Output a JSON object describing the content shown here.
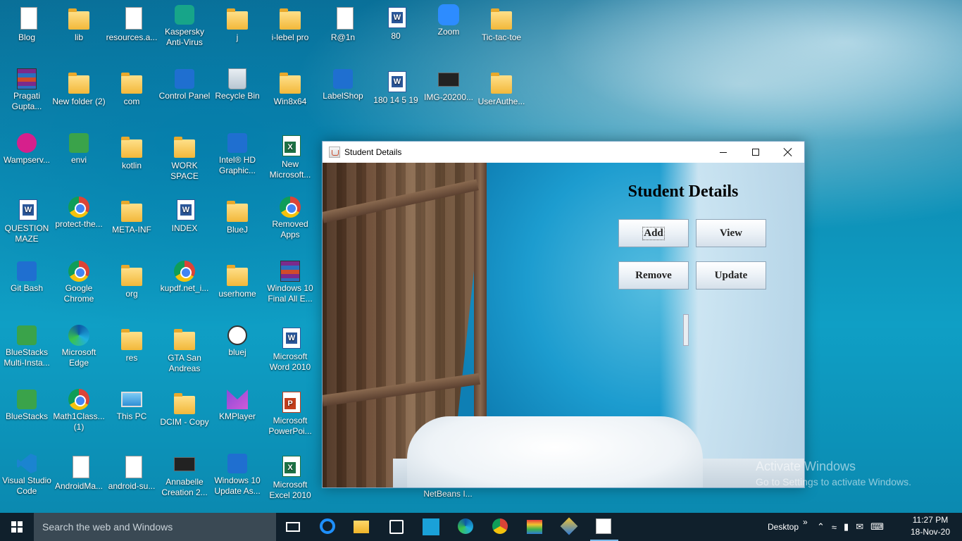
{
  "desktop": {
    "icons": [
      {
        "label": "Blog"
      },
      {
        "label": "lib"
      },
      {
        "label": "resources.a..."
      },
      {
        "label": "Kaspersky Anti-Virus"
      },
      {
        "label": "j"
      },
      {
        "label": "i-lebel pro"
      },
      {
        "label": "R@1n"
      },
      {
        "label": "80"
      },
      {
        "label": "Zoom"
      },
      {
        "label": "Tic-tac-toe"
      },
      {
        "label": "Pragati Gupta..."
      },
      {
        "label": "New folder (2)"
      },
      {
        "label": "com"
      },
      {
        "label": "Control Panel"
      },
      {
        "label": "Recycle Bin"
      },
      {
        "label": "Win8x64"
      },
      {
        "label": "LabelShop"
      },
      {
        "label": "180 14 5 19"
      },
      {
        "label": "IMG-20200..."
      },
      {
        "label": "UserAuthe..."
      },
      {
        "label": "Wampserv..."
      },
      {
        "label": "envi"
      },
      {
        "label": "kotlin"
      },
      {
        "label": "WORK SPACE"
      },
      {
        "label": "Intel® HD Graphic..."
      },
      {
        "label": "New Microsoft..."
      },
      {
        "label": "QUESTION MAZE"
      },
      {
        "label": "protect-the..."
      },
      {
        "label": "META-INF"
      },
      {
        "label": "INDEX"
      },
      {
        "label": "BlueJ"
      },
      {
        "label": "Removed Apps"
      },
      {
        "label": "Git Bash"
      },
      {
        "label": "Google Chrome"
      },
      {
        "label": "org"
      },
      {
        "label": "kupdf.net_i..."
      },
      {
        "label": "userhome"
      },
      {
        "label": "Windows 10 Final All E..."
      },
      {
        "label": "BlueStacks Multi-Insta..."
      },
      {
        "label": "Microsoft Edge"
      },
      {
        "label": "res"
      },
      {
        "label": "GTA San Andreas"
      },
      {
        "label": "bluej"
      },
      {
        "label": "Microsoft Word 2010"
      },
      {
        "label": "BlueStacks"
      },
      {
        "label": "Math1Class... (1)"
      },
      {
        "label": "This PC"
      },
      {
        "label": "DCIM - Copy"
      },
      {
        "label": "KMPlayer"
      },
      {
        "label": "Microsoft PowerPoi..."
      },
      {
        "label": "Visual Studio Code"
      },
      {
        "label": "AndroidMa..."
      },
      {
        "label": "android-su..."
      },
      {
        "label": "Annabelle Creation 2..."
      },
      {
        "label": "Windows 10 Update As..."
      },
      {
        "label": "Microsoft Excel 2010"
      }
    ],
    "netbeans_label": "NetBeans I...",
    "watermark": {
      "line1": "Activate Windows",
      "line2": "Go to Settings to activate Windows."
    }
  },
  "window": {
    "title": "Student Details",
    "heading": "Student Details",
    "buttons": {
      "add": "Add",
      "view": "View",
      "remove": "Remove",
      "update": "Update"
    }
  },
  "taskbar": {
    "search_placeholder": "Search the web and Windows",
    "desktop_label": "Desktop",
    "chevron": "»",
    "time": "11:27 PM",
    "date": "18-Nov-20"
  },
  "colors": {
    "taskbar": "#10202c",
    "search_box": "#3a4954",
    "accent": "#7cb9e8"
  }
}
